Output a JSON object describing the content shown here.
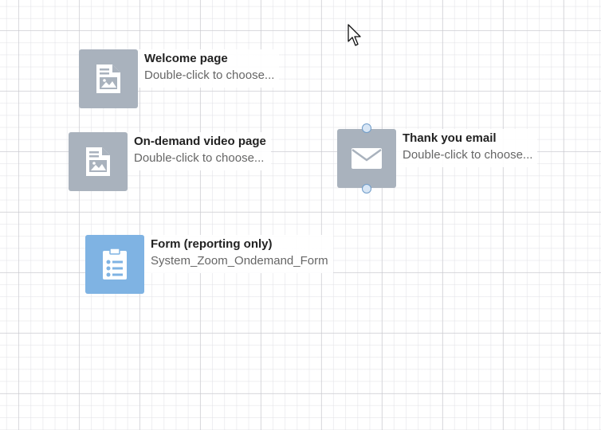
{
  "nodes": {
    "welcome": {
      "title": "Welcome page",
      "subtitle": "Double-click to choose...",
      "icon": "landing-page-icon"
    },
    "ondemand": {
      "title": "On-demand video page",
      "subtitle": "Double-click to choose...",
      "icon": "landing-page-icon"
    },
    "thankyou": {
      "title": "Thank you email",
      "subtitle": "Double-click to choose...",
      "icon": "email-icon"
    },
    "form": {
      "title": "Form (reporting only)",
      "subtitle": "System_Zoom_Ondemand_Form",
      "icon": "form-icon"
    }
  },
  "colors": {
    "tile_gray": "#a9b2bd",
    "tile_blue": "#7fb3e3",
    "handle_border": "#6f9cc9"
  }
}
